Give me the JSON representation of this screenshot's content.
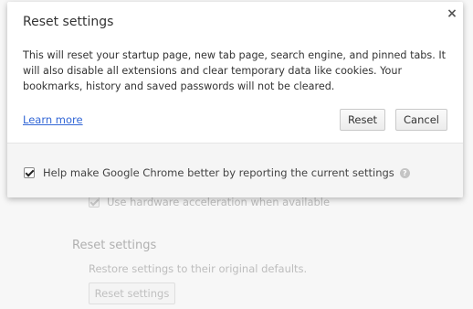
{
  "background": {
    "hardware_accel_label": "Use hardware acceleration when available",
    "reset_heading": "Reset settings",
    "reset_description": "Restore settings to their original defaults.",
    "reset_button_label": "Reset settings"
  },
  "dialog": {
    "title": "Reset settings",
    "close_icon": "×",
    "body_text": "This will reset your startup page, new tab page, search engine, and pinned tabs. It will also disable all extensions and clear temporary data like cookies. Your bookmarks, history and saved passwords will not be cleared.",
    "learn_more_label": "Learn more",
    "reset_label": "Reset",
    "cancel_label": "Cancel",
    "report_checkbox_label": "Help make Google Chrome better by reporting the current settings",
    "report_checked": true,
    "help_icon": "?"
  }
}
